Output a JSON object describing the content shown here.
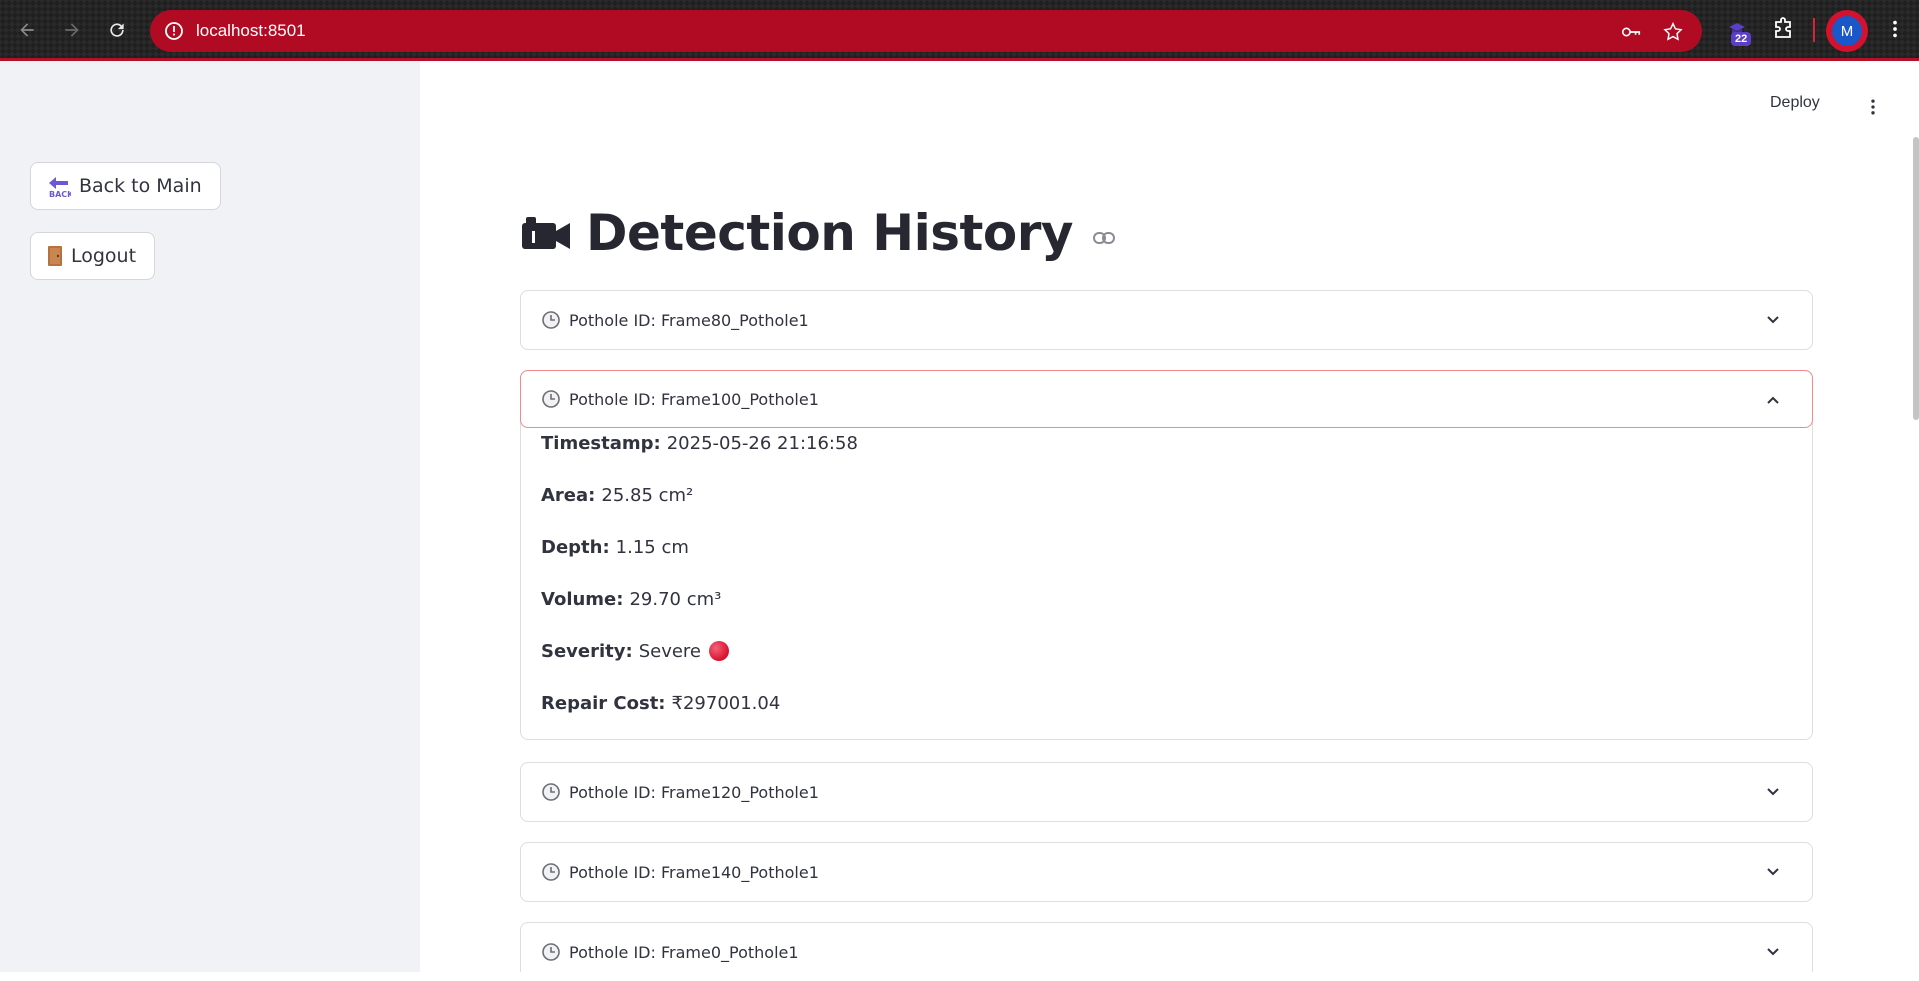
{
  "browser": {
    "url": "localhost:8501",
    "extension_badge": "22",
    "avatar_letter": "M"
  },
  "sidebar": {
    "back_label": "Back to Main",
    "logout_label": "Logout"
  },
  "header": {
    "deploy_label": "Deploy"
  },
  "main": {
    "title": "Detection History",
    "expanders": [
      {
        "label": "Pothole ID: Frame80_Pothole1",
        "expanded": false
      },
      {
        "label": "Pothole ID: Frame100_Pothole1",
        "expanded": true,
        "details": {
          "timestamp_label": "Timestamp:",
          "timestamp_value": "2025-05-26 21:16:58",
          "area_label": "Area:",
          "area_value": "25.85 cm²",
          "depth_label": "Depth:",
          "depth_value": "1.15 cm",
          "volume_label": "Volume:",
          "volume_value": "29.70 cm³",
          "severity_label": "Severity:",
          "severity_value": "Severe",
          "repair_label": "Repair Cost:",
          "repair_value": "₹297001.04"
        }
      },
      {
        "label": "Pothole ID: Frame120_Pothole1",
        "expanded": false
      },
      {
        "label": "Pothole ID: Frame140_Pothole1",
        "expanded": false
      },
      {
        "label": "Pothole ID: Frame0_Pothole1",
        "expanded": false
      }
    ]
  },
  "colors": {
    "accent": "#b10b23",
    "severity_dot": "#e0203b",
    "sidebar_bg": "#f0f2f6"
  }
}
